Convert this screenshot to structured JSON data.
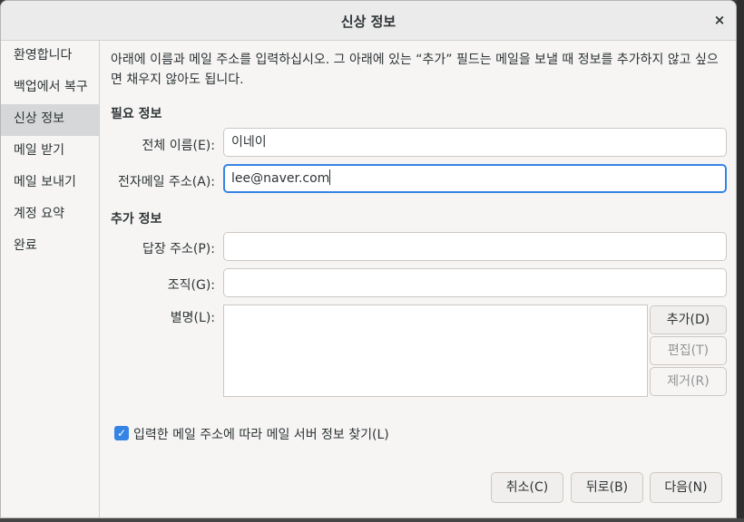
{
  "window": {
    "title": "신상 정보",
    "close_label": "×"
  },
  "sidebar": {
    "items": [
      {
        "label": "환영합니다",
        "active": false
      },
      {
        "label": "백업에서 복구",
        "active": false
      },
      {
        "label": "신상 정보",
        "active": true
      },
      {
        "label": "메일 받기",
        "active": false
      },
      {
        "label": "메일 보내기",
        "active": false
      },
      {
        "label": "계정 요약",
        "active": false
      },
      {
        "label": "완료",
        "active": false
      }
    ]
  },
  "intro": {
    "line1": "아래에 이름과 메일 주소를 입력하십시오. 그 아래에 있는 “추가” 필드는 메일을 보낼 때 정보를 추가하지 않고 싶으",
    "line2": "면 채우지 않아도 됩니다."
  },
  "required": {
    "heading": "필요 정보",
    "full_name": {
      "label": "전체 이름(E):",
      "value": "이네이"
    },
    "email": {
      "label": "전자메일 주소(A):",
      "value": "lee@naver.com"
    }
  },
  "optional": {
    "heading": "추가 정보",
    "reply_to": {
      "label": "답장 주소(P):",
      "value": ""
    },
    "organization": {
      "label": "조직(G):",
      "value": ""
    },
    "aliases": {
      "label": "별명(L):",
      "add_label": "추가(D)",
      "edit_label": "편집(T)",
      "remove_label": "제거(R)"
    }
  },
  "lookup": {
    "label": "입력한 메일 주소에 따라 메일 서버 정보 찾기(L)",
    "checked": true
  },
  "buttons": {
    "cancel": "취소(C)",
    "back": "뒤로(B)",
    "next": "다음(N)"
  },
  "colors": {
    "accent": "#3584e4",
    "sidebar_active": "#d6d7d8"
  }
}
